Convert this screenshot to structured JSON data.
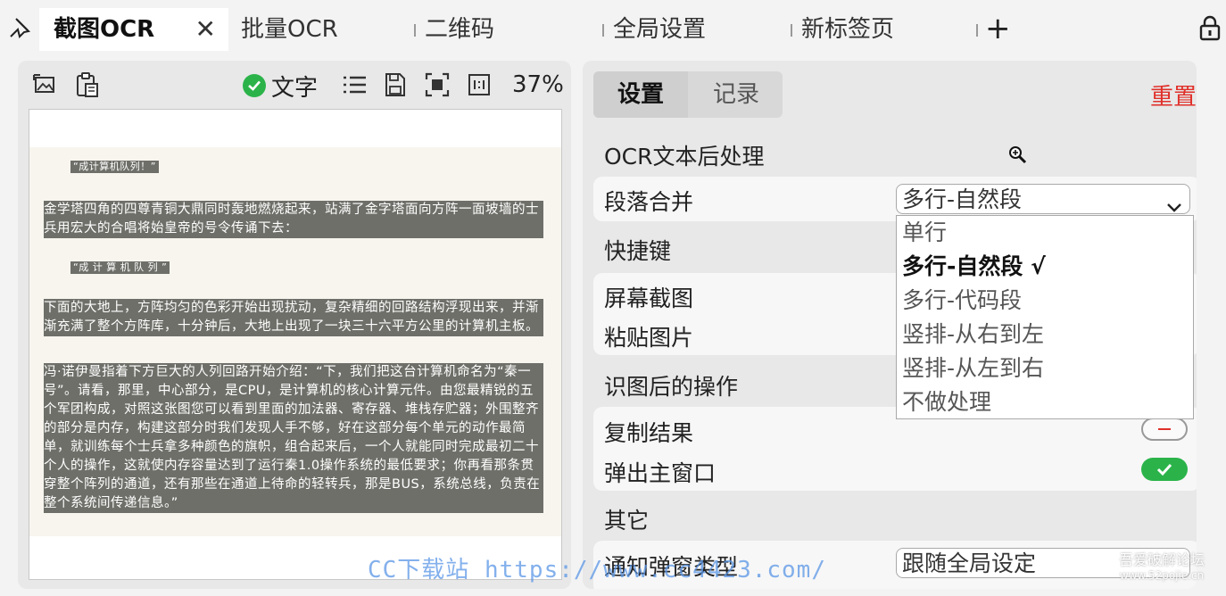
{
  "tabs": {
    "pin_icon": "pin-icon",
    "items": [
      {
        "label": "截图OCR",
        "active": true
      },
      {
        "label": "批量OCR"
      },
      {
        "label": "二维码"
      },
      {
        "label": "全局设置"
      },
      {
        "label": "新标签页"
      }
    ],
    "close_glyph": "✕",
    "add_glyph": "+"
  },
  "left": {
    "text_toggle_label": "文字",
    "zoom": "37%",
    "ocr_blocks": [
      "“成计算机队列！”",
      "金学塔四角的四尊青铜大鼎同时轰地燃烧起来，站满了金字塔面向方阵一面坡墙的士兵用宏大的合唱将始皇帝的号令传诵下去：",
      "“成 计 算 机 队 列 ”",
      "下面的大地上，方阵均匀的色彩开始出现扰动，复杂精细的回路结构浮现出来，并渐渐充满了整个方阵库，十分钟后，大地上出现了一块三十六平方公里的计算机主板。",
      "冯·诺伊曼指着下方巨大的人列回路开始介绍：“下，我们把这台计算机命名为“秦一号”。请看，那里，中心部分，是CPU，是计算机的核心计算元件。由您最精锐的五个军团构成，对照这张图您可以看到里面的加法器、寄存器、堆栈存贮器；外围整齐的部分是内存，构建这部分时我们发现人手不够，好在这部分每个单元的动作最简单，就训练每个士兵拿多种颜色的旗帜，组合起来后，一个人就能同时完成最初二十个人的操作，这就使内存容量达到了运行秦1.0操作系统的最低要求；你再看那条贯穿整个阵列的通道，还有那些在通道上待命的轻转兵，那是BUS，系统总线，负责在整个系统间传递信息。”"
    ]
  },
  "right": {
    "segments": {
      "settings": "设置",
      "records": "记录"
    },
    "reset": "重置",
    "post_process_title": "OCR文本后处理",
    "paragraph_merge_label": "段落合并",
    "paragraph_merge_value": "多行-自然段",
    "dropdown_options": [
      "单行",
      "多行-自然段 √",
      "多行-代码段",
      "竖排-从右到左",
      "竖排-从左到右",
      "不做处理"
    ],
    "hotkey_title": "快捷键",
    "screenshot_label": "屏幕截图",
    "paste_label": "粘贴图片",
    "after_ocr_title": "识图后的操作",
    "copy_result_label": "复制结果",
    "popup_main_label": "弹出主窗口",
    "other_title": "其它",
    "notify_label": "通知弹窗类型",
    "notify_value": "跟随全局设定"
  },
  "watermarks": {
    "cc": "CC下载站  https://www.cc4423.com/",
    "wuai": "吾爱破解论坛",
    "wuai_url": "www.52pojie.cn"
  },
  "colors": {
    "accent_green": "#2bb34a",
    "reset_red": "#e0302a"
  }
}
